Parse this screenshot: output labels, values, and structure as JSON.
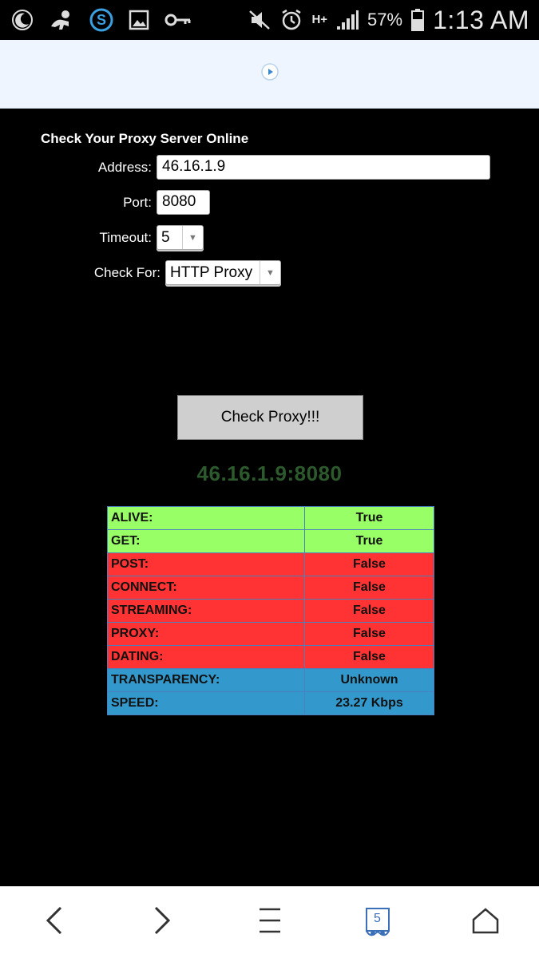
{
  "status_bar": {
    "battery_percent": "57%",
    "time": "1:13 AM",
    "network_type": "H+",
    "icons": [
      "moon-icon",
      "baby-icon",
      "s-app-icon",
      "gallery-icon",
      "key-icon",
      "mute-icon",
      "alarm-icon",
      "signal-icon",
      "battery-icon"
    ]
  },
  "ad_banner": {
    "icon": "play-circle-icon"
  },
  "form": {
    "title": "Check Your Proxy Server Online",
    "address_label": "Address:",
    "address_value": "46.16.1.9",
    "port_label": "Port:",
    "port_value": "8080",
    "timeout_label": "Timeout:",
    "timeout_value": "5",
    "check_for_label": "Check For:",
    "check_for_value": "HTTP Proxy",
    "submit_label": "Check Proxy!!!"
  },
  "result": {
    "host": "46.16.1.9:8080",
    "rows": [
      {
        "label": "ALIVE:",
        "value": "True",
        "status": "green"
      },
      {
        "label": "GET:",
        "value": "True",
        "status": "green"
      },
      {
        "label": "POST:",
        "value": "False",
        "status": "red"
      },
      {
        "label": "CONNECT:",
        "value": "False",
        "status": "red"
      },
      {
        "label": "STREAMING:",
        "value": "False",
        "status": "red"
      },
      {
        "label": "PROXY:",
        "value": "False",
        "status": "red"
      },
      {
        "label": "DATING:",
        "value": "False",
        "status": "red"
      },
      {
        "label": "TRANSPARENCY:",
        "value": "Unknown",
        "status": "blue"
      },
      {
        "label": "SPEED:",
        "value": "23.27 Kbps",
        "status": "blue"
      }
    ]
  },
  "bottom_nav": {
    "tab_count": "5",
    "icons": [
      "back-arrow-icon",
      "forward-arrow-icon",
      "menu-icon",
      "tabs-icon",
      "home-icon"
    ]
  },
  "colors": {
    "alive_green": "#99ff66",
    "fail_red": "#ff3333",
    "info_blue": "#3399cc",
    "host_text": "#2d5a2d"
  }
}
